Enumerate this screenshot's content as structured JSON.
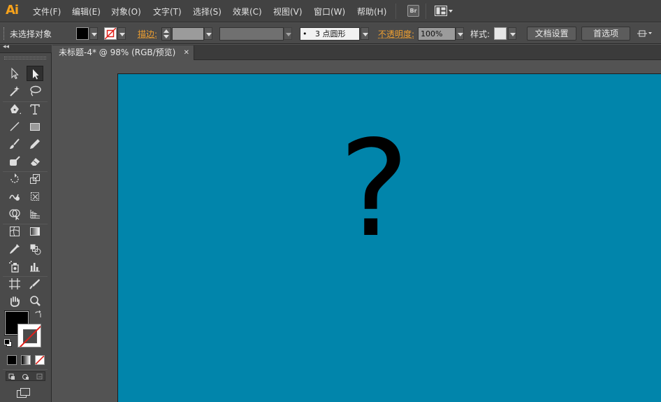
{
  "app": {
    "logo": "Ai"
  },
  "menu": {
    "items": [
      "文件(F)",
      "编辑(E)",
      "对象(O)",
      "文字(T)",
      "选择(S)",
      "效果(C)",
      "视图(V)",
      "窗口(W)",
      "帮助(H)"
    ],
    "bridge_label": "Br"
  },
  "control": {
    "selection_status": "未选择对象",
    "stroke_label": "描边:",
    "brush_value": "3 点圆形",
    "brush_bullet": "•",
    "opacity_label": "不透明度:",
    "opacity_value": "100%",
    "style_label": "样式:",
    "doc_setup_button": "文档设置",
    "prefs_button": "首选项"
  },
  "tools": {
    "collapse_glyph": "◂◂"
  },
  "document": {
    "tab_title": "未标题-4* @ 98% (RGB/预览)",
    "close_glyph": "✕",
    "content_glyph": "?"
  },
  "colors": {
    "artboard": "#0185AB",
    "fill": "#000000",
    "stroke": "none",
    "accent": "#F7A21B"
  }
}
